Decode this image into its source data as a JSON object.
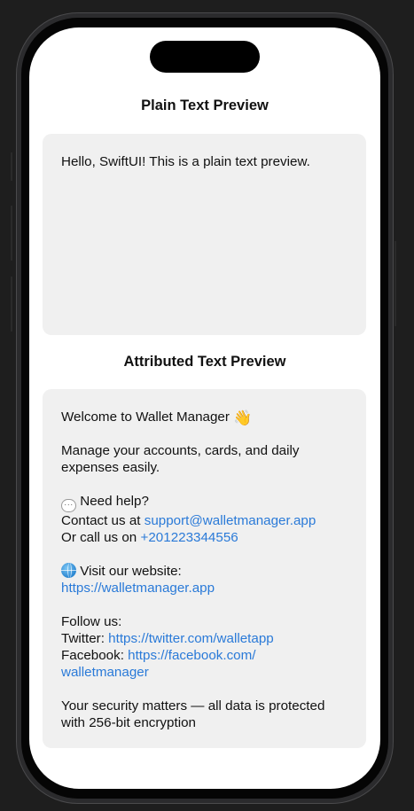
{
  "plain_section": {
    "title": "Plain Text Preview",
    "text": "Hello, SwiftUI! This is a plain text preview."
  },
  "attributed_section": {
    "title": "Attributed Text Preview",
    "welcome": "Welcome to Wallet Manager",
    "welcome_icon": "waving-hand-icon",
    "manage_line_1": "Manage your accounts, cards, and daily",
    "manage_line_2": "expenses easily.",
    "help_icon": "speech-bubble-icon",
    "help_title": "Need help?",
    "contact_prefix": "Contact us at ",
    "contact_email": "support@walletmanager.app",
    "call_prefix": "Or call us on ",
    "call_phone": "+201223344556",
    "website_icon": "globe-icon",
    "website_title": "Visit our website:",
    "website_url": "https://walletmanager.app",
    "follow_title": "Follow us:",
    "twitter_prefix": "Twitter: ",
    "twitter_url": "https://twitter.com/walletapp",
    "facebook_prefix": "Facebook: ",
    "facebook_url_part1": "https://facebook.com/",
    "facebook_url_part2": "walletmanager",
    "security_line_1": "Your security matters — all data is protected",
    "security_line_2": "with 256-bit encryption"
  },
  "colors": {
    "link": "#2a7ad8",
    "card_background": "#f0f0f0",
    "screen_background": "#ffffff"
  }
}
